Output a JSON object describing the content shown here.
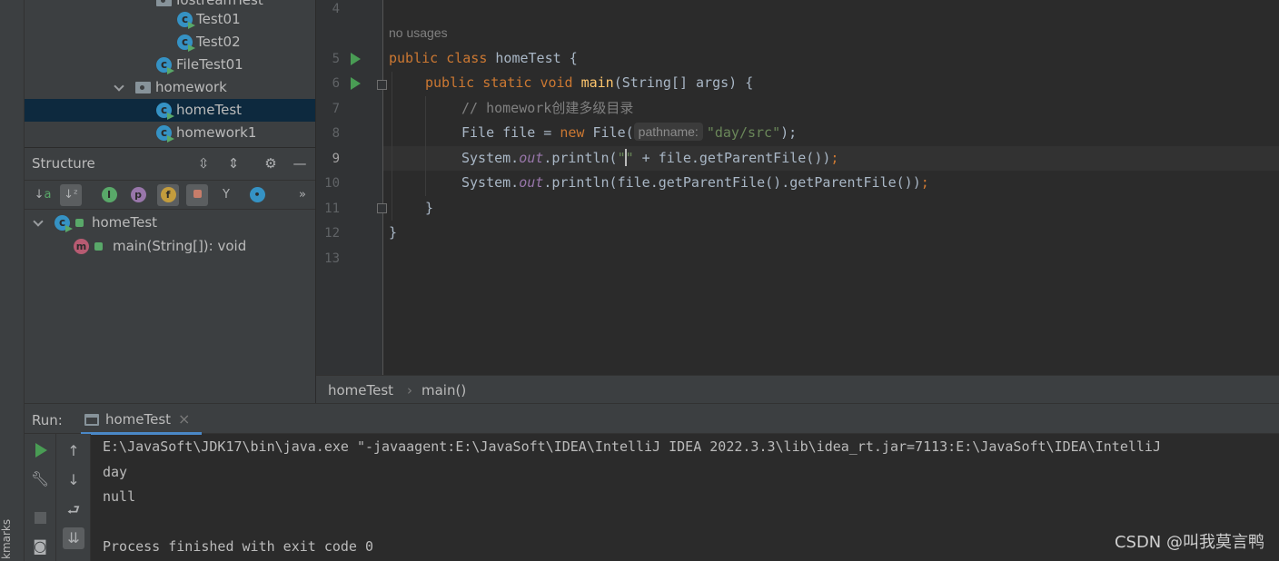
{
  "sidebar": {
    "bookmarks_label": "kmarks"
  },
  "project_tree": {
    "rows": [
      {
        "label": "IostreamTest",
        "type": "folder"
      },
      {
        "label": "Test01",
        "type": "class"
      },
      {
        "label": "Test02",
        "type": "class"
      },
      {
        "label": "FileTest01",
        "type": "class"
      },
      {
        "label": "homework",
        "type": "folder"
      },
      {
        "label": "homeTest",
        "type": "class",
        "selected": true
      },
      {
        "label": "homework1",
        "type": "class"
      }
    ]
  },
  "structure": {
    "title": "Structure",
    "root": {
      "label": "homeTest",
      "icon": "class-icon"
    },
    "child": {
      "label": "main(String[]): void",
      "icon": "method-icon"
    }
  },
  "editor": {
    "no_usages": "no usages",
    "line_numbers": [
      "4",
      "5",
      "6",
      "7",
      "8",
      "9",
      "10",
      "11",
      "12",
      "13"
    ],
    "current_line": "9",
    "code": {
      "l5_kw1": "public",
      "l5_kw2": "class",
      "l5_name": "homeTest",
      "l5_brace": "{",
      "l6_kw1": "public",
      "l6_kw2": "static",
      "l6_kw3": "void",
      "l6_fn": "main",
      "l6_rest": "(String[] args) {",
      "l7_comment": "// homework创建多级目录",
      "l8_a": "File file = ",
      "l8_new": "new",
      "l8_b": " File(",
      "l8_hint": "pathname:",
      "l8_str": "\"day/src\"",
      "l8_c": ");",
      "l9_a": "System.",
      "l9_out": "out",
      "l9_b": ".println(",
      "l9_str1": "\"",
      "l9_str2": "\"",
      "l9_c": " + file.getParentFile())",
      "l9_semi": ";",
      "l10_a": "System.",
      "l10_out": "out",
      "l10_b": ".println(file.getParentFile().getParentFile())",
      "l10_semi": ";",
      "l11": "}",
      "l12": "}"
    }
  },
  "breadcrumbs": {
    "class": "homeTest",
    "sep": "›",
    "method": "main()"
  },
  "run": {
    "label": "Run:",
    "tab_label": "homeTest",
    "tab_close": "×",
    "console_lines": [
      "E:\\JavaSoft\\JDK17\\bin\\java.exe \"-javaagent:E:\\JavaSoft\\IDEA\\IntelliJ IDEA 2022.3.3\\lib\\idea_rt.jar=7113:E:\\JavaSoft\\IDEA\\IntelliJ",
      "day",
      "null",
      "",
      "Process finished with exit code 0"
    ]
  },
  "watermark": "CSDN @叫我莫言鸭",
  "colors": {
    "keyword": "#cc7832",
    "function": "#ffc66d",
    "string": "#6a8759",
    "field": "#9876aa",
    "comment": "#808080",
    "selection": "#0d293e",
    "run_green": "#499c54"
  }
}
